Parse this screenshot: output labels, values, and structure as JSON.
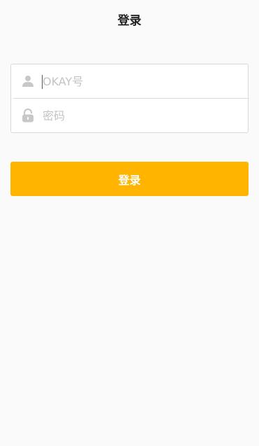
{
  "header": {
    "title": "登录"
  },
  "form": {
    "account": {
      "placeholder": "OKAY号",
      "value": "",
      "icon": "user-icon"
    },
    "password": {
      "placeholder": "密码",
      "value": "",
      "icon": "lock-icon"
    }
  },
  "actions": {
    "login_label": "登录"
  },
  "colors": {
    "accent": "#ffb400",
    "background": "#fafafa",
    "icon": "#c8c8c8",
    "border": "#d9d9d9"
  }
}
